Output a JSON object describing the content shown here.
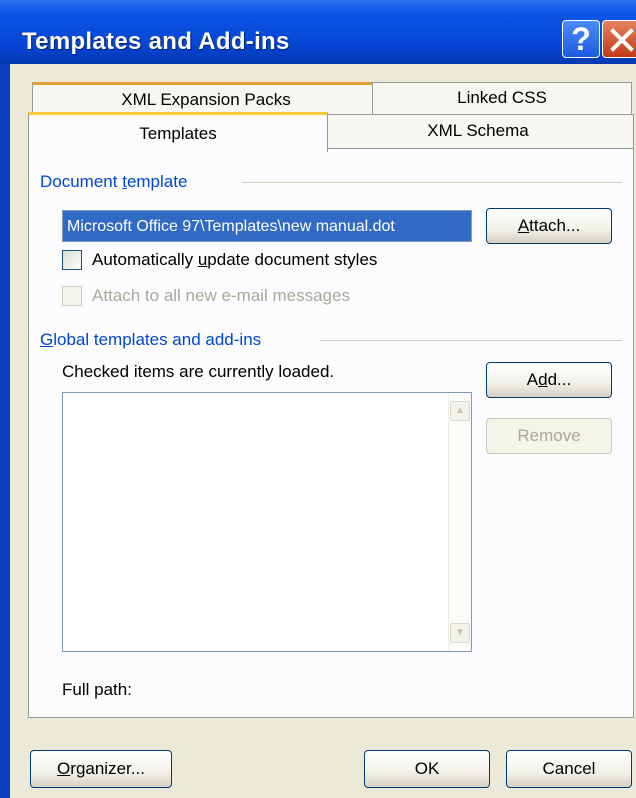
{
  "window": {
    "title": "Templates and Add-ins"
  },
  "tabs": {
    "row_back": [
      "XML Expansion Packs",
      "Linked CSS"
    ],
    "row_front": [
      "Templates",
      "XML Schema"
    ]
  },
  "document_template": {
    "label_prefix": "Document ",
    "label_accel": "t",
    "label_suffix": "emplate",
    "path_value": "Microsoft Office 97\\Templates\\new manual.dot",
    "attach_prefix": "",
    "attach_accel": "A",
    "attach_suffix": "ttach...",
    "auto_update_prefix": "Automatically ",
    "auto_update_accel": "u",
    "auto_update_suffix": "pdate document styles",
    "attach_email_label": "Attach to all new e-mail messages"
  },
  "global_templates": {
    "label_prefix": "",
    "label_accel": "G",
    "label_suffix": "lobal templates and add-ins",
    "hint": "Checked items are currently loaded.",
    "add_prefix": "A",
    "add_accel": "d",
    "add_suffix": "d...",
    "remove_label": "Remove",
    "full_path_label": "Full path:"
  },
  "footer": {
    "organizer_prefix": "",
    "organizer_accel": "O",
    "organizer_suffix": "rganizer...",
    "ok_label": "OK",
    "cancel_label": "Cancel"
  },
  "icons": {
    "help": "help-icon",
    "close": "close-icon",
    "scroll_up": "scroll-up-arrow-icon",
    "scroll_down": "scroll-down-arrow-icon"
  },
  "colors": {
    "titlebar": "#0646d4",
    "dialog_bg": "#ece9d8",
    "group_label": "#0046d5",
    "selection": "#316ac5"
  }
}
